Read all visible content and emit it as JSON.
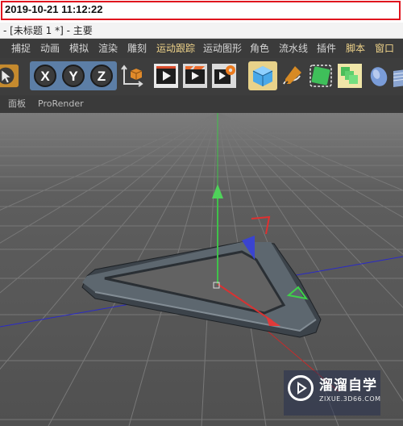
{
  "timestamp": "2019-10-21 11:12:22",
  "window": {
    "title": "- [未标题 1 *] - 主要"
  },
  "menu": {
    "items": [
      "捕捉",
      "动画",
      "模拟",
      "渲染",
      "雕刻",
      "运动跟踪",
      "运动图形",
      "角色",
      "流水线",
      "插件",
      "脚本",
      "窗口"
    ],
    "highlight_colors": {
      "normal": "#d6d6d6",
      "accent": "#f0d48a"
    }
  },
  "toolbar": {
    "icons": [
      "select-arrow-icon",
      "lock-x-axis-icon",
      "lock-y-axis-icon",
      "lock-z-axis-icon",
      "world-coordinates-icon",
      "render-view-icon",
      "render-picture-viewer-icon",
      "render-settings-icon",
      "cube-icon",
      "pen-spline-icon",
      "subdivision-surface-icon",
      "cloner-icon",
      "deformer-icon",
      "scene-icon"
    ],
    "axis_labels": {
      "x": "X",
      "y": "Y",
      "z": "Z"
    }
  },
  "panel": {
    "items": [
      "面板",
      "ProRender"
    ]
  },
  "viewport": {
    "grid_color": "#7a7a7a",
    "background": "#5f5f5f"
  },
  "watermark": {
    "title": "溜溜自学",
    "url": "ZIXUE.3D66.COM"
  }
}
